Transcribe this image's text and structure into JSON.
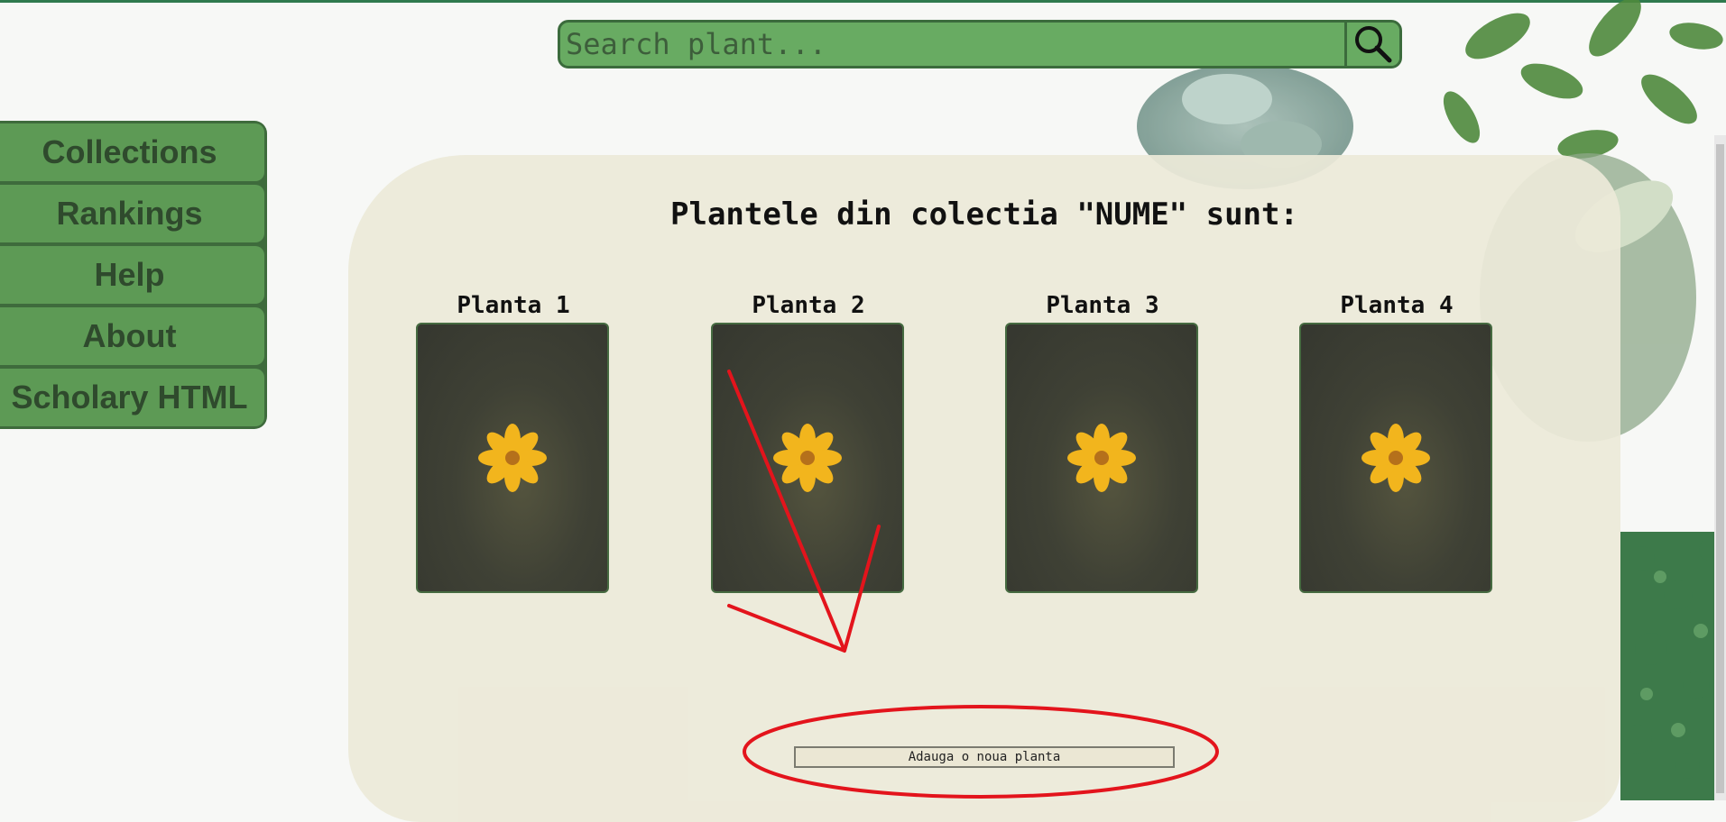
{
  "search": {
    "placeholder": "Search plant..."
  },
  "sidebar": {
    "items": [
      {
        "label": "Collections"
      },
      {
        "label": "Rankings"
      },
      {
        "label": "Help"
      },
      {
        "label": "About"
      },
      {
        "label": "Scholary HTML"
      }
    ]
  },
  "main": {
    "heading": "Plantele din colectia \"NUME\" sunt:",
    "plants": [
      {
        "name": "Planta 1"
      },
      {
        "name": "Planta 2"
      },
      {
        "name": "Planta 3"
      },
      {
        "name": "Planta 4"
      }
    ],
    "add_button": "Adauga o noua planta"
  },
  "colors": {
    "accent_green": "#68ab62",
    "sidebar_green": "#5d9a55",
    "panel_beige": "#ece9d8",
    "annotation_red": "#e3141c"
  }
}
